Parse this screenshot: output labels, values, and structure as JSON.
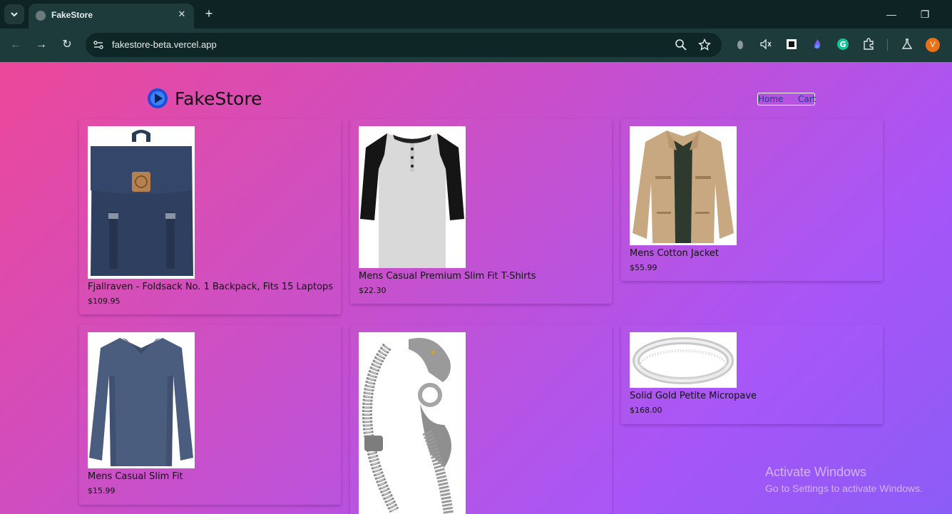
{
  "browser": {
    "tab_title": "FakeStore",
    "url": "fakestore-beta.vercel.app",
    "profile_initial": "V"
  },
  "site": {
    "brand": "FakeStore",
    "nav": {
      "home": "Home",
      "cart": "Cart"
    }
  },
  "products": [
    {
      "name": "Fjallraven - Foldsack No. 1 Backpack, Fits 15 Laptops",
      "price": "$109.95",
      "image": "backpack"
    },
    {
      "name": "Mens Casual Premium Slim Fit T-Shirts",
      "price": "$22.30",
      "image": "raglan-tshirt"
    },
    {
      "name": "Mens Cotton Jacket",
      "price": "$55.99",
      "image": "jacket"
    },
    {
      "name": "Mens Casual Slim Fit",
      "price": "$15.99",
      "image": "longsleeve-shirt"
    },
    {
      "name": "",
      "price": "",
      "image": "dragon-bracelet"
    },
    {
      "name": "Solid Gold Petite Micropave",
      "price": "$168.00",
      "image": "ring"
    }
  ],
  "watermark": {
    "line1": "Activate Windows",
    "line2": "Go to Settings to activate Windows."
  }
}
